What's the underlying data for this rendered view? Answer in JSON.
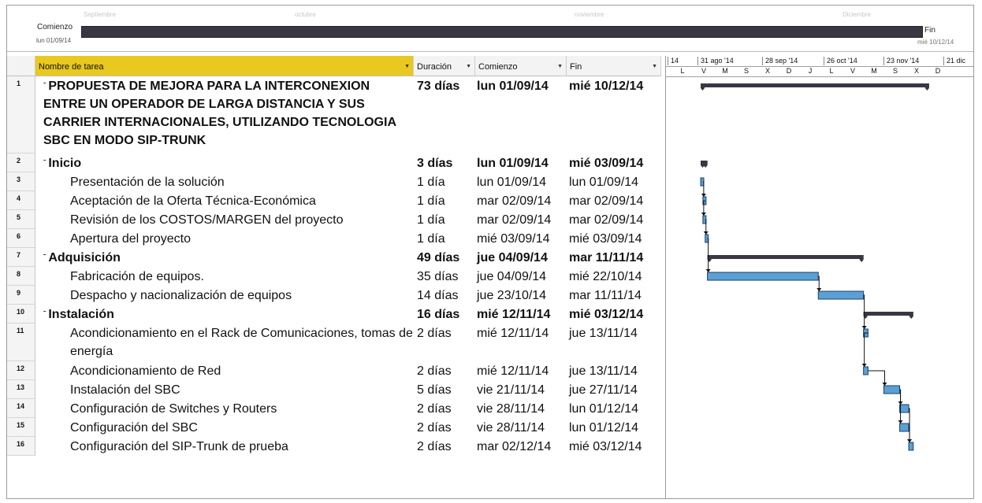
{
  "timeline": {
    "faint_labels": [
      "Septiembre",
      "octubre",
      "noviembre",
      "Diciembre"
    ],
    "start_label": "Comienzo",
    "start_date": "lun 01/09/14",
    "end_label": "Fin",
    "end_date": "mié 10/12/14"
  },
  "columns": {
    "name": "Nombre de tarea",
    "duration": "Duración",
    "start": "Comienzo",
    "finish": "Fin"
  },
  "gantt_header": {
    "months": [
      "14",
      "31 ago '14",
      "28 sep '14",
      "26 oct '14",
      "23 nov '14",
      "21 dic"
    ],
    "days": [
      "L",
      "V",
      "M",
      "S",
      "X",
      "D",
      "J",
      "L",
      "V",
      "M",
      "S",
      "X",
      "D"
    ]
  },
  "tasks": [
    {
      "id": "1",
      "name": "PROPUESTA DE MEJORA PARA LA INTERCONEXION ENTRE UN OPERADOR DE LARGA DISTANCIA Y SUS CARRIER INTERNACIONALES, UTILIZANDO TECNOLOGIA SBC EN MODO SIP-TRUNK",
      "duration": "73 días",
      "start": "lun 01/09/14",
      "finish": "mié 10/12/14",
      "level": 0,
      "summary": true
    },
    {
      "id": "2",
      "name": "Inicio",
      "duration": "3 días",
      "start": "lun 01/09/14",
      "finish": "mié 03/09/14",
      "level": 1,
      "summary": true
    },
    {
      "id": "3",
      "name": "Presentación de la solución",
      "duration": "1 día",
      "start": "lun 01/09/14",
      "finish": "lun 01/09/14",
      "level": 2,
      "summary": false
    },
    {
      "id": "4",
      "name": "Aceptación de la Oferta Técnica-Económica",
      "duration": "1 día",
      "start": "mar 02/09/14",
      "finish": "mar 02/09/14",
      "level": 2,
      "summary": false
    },
    {
      "id": "5",
      "name": "Revisión de los COSTOS/MARGEN del proyecto",
      "duration": "1 día",
      "start": "mar 02/09/14",
      "finish": "mar 02/09/14",
      "level": 2,
      "summary": false
    },
    {
      "id": "6",
      "name": "Apertura del proyecto",
      "duration": "1 día",
      "start": "mié 03/09/14",
      "finish": "mié 03/09/14",
      "level": 2,
      "summary": false
    },
    {
      "id": "7",
      "name": "Adquisición",
      "duration": "49 días",
      "start": "jue 04/09/14",
      "finish": "mar 11/11/14",
      "level": 1,
      "summary": true
    },
    {
      "id": "8",
      "name": "Fabricación de equipos.",
      "duration": "35 días",
      "start": "jue 04/09/14",
      "finish": "mié 22/10/14",
      "level": 2,
      "summary": false
    },
    {
      "id": "9",
      "name": "Despacho y nacionalización de equipos",
      "duration": "14 días",
      "start": "jue 23/10/14",
      "finish": "mar 11/11/14",
      "level": 2,
      "summary": false
    },
    {
      "id": "10",
      "name": "Instalación",
      "duration": "16 días",
      "start": "mié 12/11/14",
      "finish": "mié 03/12/14",
      "level": 1,
      "summary": true
    },
    {
      "id": "11",
      "name": "Acondicionamiento en el Rack de Comunicaciones, tomas de energía",
      "duration": "2 días",
      "start": "mié 12/11/14",
      "finish": "jue 13/11/14",
      "level": 2,
      "summary": false
    },
    {
      "id": "12",
      "name": "Acondicionamiento de Red",
      "duration": "2 días",
      "start": "mié 12/11/14",
      "finish": "jue 13/11/14",
      "level": 2,
      "summary": false
    },
    {
      "id": "13",
      "name": "Instalación del SBC",
      "duration": "5 días",
      "start": "vie 21/11/14",
      "finish": "jue 27/11/14",
      "level": 2,
      "summary": false
    },
    {
      "id": "14",
      "name": "Configuración de Switches y Routers",
      "duration": "2 días",
      "start": "vie 28/11/14",
      "finish": "lun 01/12/14",
      "level": 2,
      "summary": false
    },
    {
      "id": "15",
      "name": "Configuración del SBC",
      "duration": "2 días",
      "start": "vie 28/11/14",
      "finish": "lun 01/12/14",
      "level": 2,
      "summary": false
    },
    {
      "id": "16",
      "name": "Configuración del SIP-Trunk de prueba",
      "duration": "2 días",
      "start": "mar 02/12/14",
      "finish": "mié 03/12/14",
      "level": 2,
      "summary": false
    }
  ],
  "colors": {
    "summary_bar": "#3a3642",
    "task_bar": "#5aa0d6",
    "header_highlight": "#e9c81f"
  }
}
